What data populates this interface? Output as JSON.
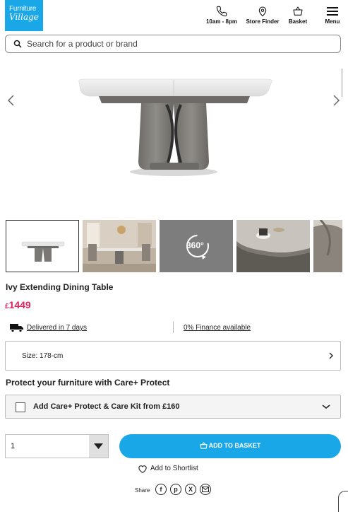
{
  "header": {
    "logo_line1": "Furniture",
    "logo_line2": "Village",
    "hours_label": "10am - 8pm",
    "store_label": "Store Finder",
    "basket_label": "Basket",
    "menu_label": "Menu",
    "brand_color": "#1aa7e8"
  },
  "search": {
    "placeholder": "Search for a product or brand",
    "value": ""
  },
  "gallery": {
    "prev_icon": "chevron-left-icon",
    "next_icon": "chevron-right-icon",
    "thumbnails": [
      "table-front",
      "dining-room",
      "360-view",
      "table-top-detail",
      "table-edge-detail"
    ],
    "view360_label": "360°"
  },
  "product": {
    "title": "Ivy Extending Dining Table",
    "currency": "£",
    "price": "1449",
    "price_color": "#e0245e",
    "delivery": "Delivered in 7 days",
    "finance": "0% Finance available",
    "size_label": "Size: 178-cm"
  },
  "protect": {
    "title": "Protect your furniture with Care+ Protect",
    "option_label": "Add Care+ Protect & Care Kit from £160"
  },
  "purchase": {
    "quantity": "1",
    "add_label": "ADD TO BASKET",
    "shortlist_label": "Add to Shortlist"
  },
  "share": {
    "label": "Share",
    "icons": [
      "facebook-icon",
      "pinterest-icon",
      "x-icon",
      "email-icon"
    ]
  }
}
